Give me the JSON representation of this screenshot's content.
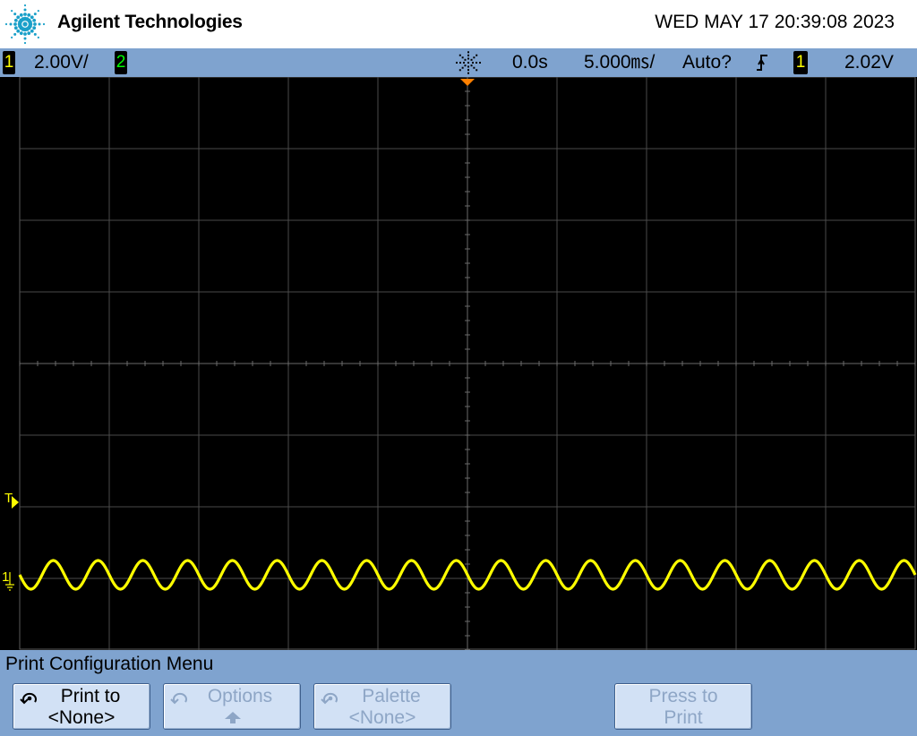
{
  "header": {
    "brand": "Agilent Technologies",
    "datetime": "WED MAY 17 20:39:08 2023"
  },
  "status": {
    "ch1_label": "1",
    "ch1_scale": "2.00V/",
    "ch2_label": "2",
    "acq_icon": "acquisition-run-icon",
    "time_delay": "0.0s",
    "time_scale": "5.000㎳/",
    "trigger_mode": "Auto?",
    "trigger_edge_icon": "rising-edge-icon",
    "trigger_source": "1",
    "trigger_level": "2.02V"
  },
  "markers": {
    "trigger_level_marker": "T",
    "ch1_ground_marker": "1"
  },
  "menu": {
    "title": "Print Configuration Menu",
    "softkeys": [
      {
        "line1": "Print to",
        "line2": "<None>",
        "enabled": true,
        "icon": "entry-knob-icon"
      },
      {
        "line1": "Options",
        "line2": "",
        "enabled": false,
        "icon": "entry-knob-icon"
      },
      {
        "line1": "Palette",
        "line2": "<None>",
        "enabled": false,
        "icon": "entry-knob-icon"
      },
      {
        "line1": "Press to",
        "line2": "Print",
        "enabled": false
      }
    ]
  },
  "colors": {
    "ch1": "#ffff00",
    "ch2": "#00ff00",
    "bar": "#7fa3cf",
    "softkey": "#d2e1f5",
    "trigger_marker": "#ff8000"
  },
  "trace": {
    "channel": "1",
    "waveform": "sine",
    "cycles_on_screen": 20,
    "amplitude_divisions": 0.2,
    "offset_divisions": -2.95
  }
}
